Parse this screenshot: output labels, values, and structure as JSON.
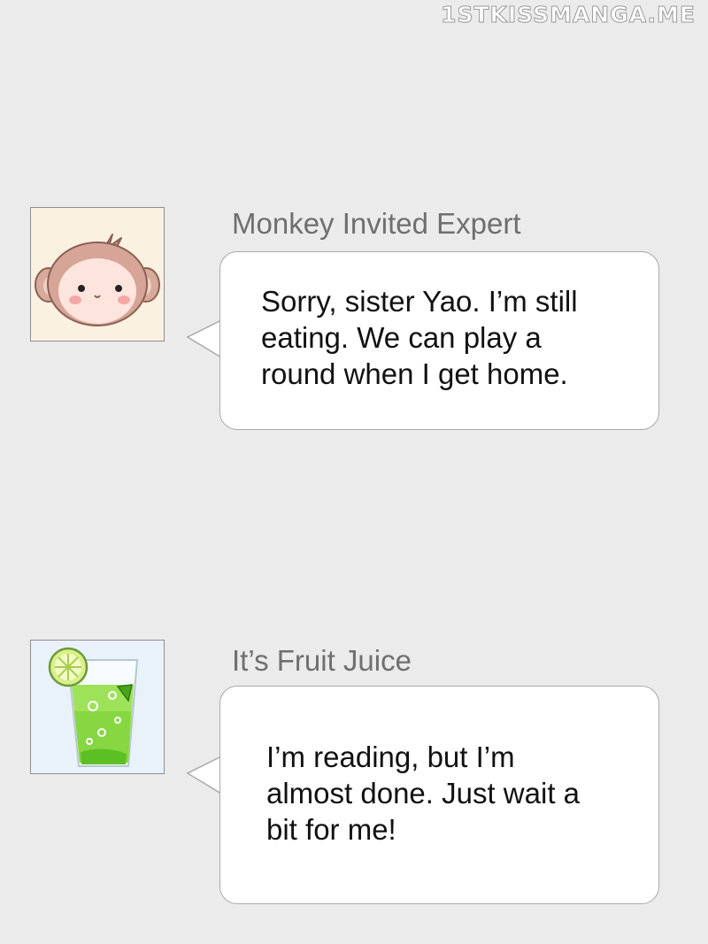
{
  "watermark": "1STKISSMANGA.ME",
  "messages": [
    {
      "sender": "Monkey Invited Expert",
      "avatar_icon": "monkey-face-icon",
      "lines": [
        "Sorry, sister Yao. I’m still",
        "eating. We can play a",
        "round when I get home."
      ]
    },
    {
      "sender": "It’s Fruit Juice",
      "avatar_icon": "lime-juice-glass-icon",
      "lines": [
        "I’m reading, but I’m",
        "almost done. Just wait a",
        "bit for me!"
      ]
    }
  ]
}
